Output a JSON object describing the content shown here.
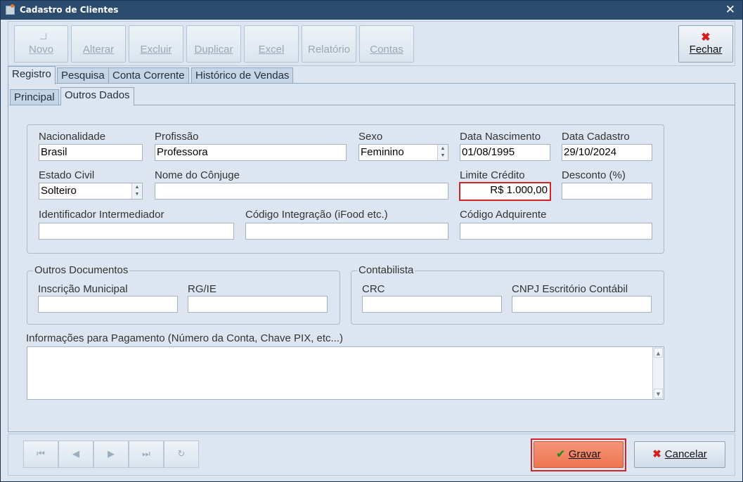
{
  "window": {
    "title": "Cadastro de Clientes",
    "close": "✕"
  },
  "toolbar": {
    "novo": "Novo",
    "alterar": "Alterar",
    "excluir": "Excluir",
    "duplicar": "Duplicar",
    "excel": "Excel",
    "relatorio": "Relatório",
    "contas": "Contas",
    "fechar": "Fechar"
  },
  "tabs": [
    "Registro",
    "Pesquisa",
    "Conta Corrente",
    "Histórico de Vendas"
  ],
  "subtabs": [
    "Principal",
    "Outros Dados"
  ],
  "form": {
    "nacionalidade": {
      "label": "Nacionalidade",
      "value": "Brasil"
    },
    "profissao": {
      "label": "Profissão",
      "value": "Professora"
    },
    "sexo": {
      "label": "Sexo",
      "value": "Feminino"
    },
    "data_nascimento": {
      "label": "Data Nascimento",
      "value": "01/08/1995"
    },
    "data_cadastro": {
      "label": "Data Cadastro",
      "value": "29/10/2024"
    },
    "estado_civil": {
      "label": "Estado Civil",
      "value": "Solteiro"
    },
    "nome_conjuge": {
      "label": "Nome do Cônjuge",
      "value": ""
    },
    "limite_credito": {
      "label": "Limite Crédito",
      "value": "R$ 1.000,00"
    },
    "desconto": {
      "label": "Desconto (%)",
      "value": ""
    },
    "identificador_intermediador": {
      "label": "Identificador Intermediador",
      "value": ""
    },
    "codigo_integracao": {
      "label": "Código Integração (iFood etc.)",
      "value": ""
    },
    "codigo_adquirente": {
      "label": "Código Adquirente",
      "value": ""
    }
  },
  "outros_documentos": {
    "legend": "Outros Documentos",
    "inscricao_municipal": {
      "label": "Inscrição Municipal",
      "value": ""
    },
    "rg_ie": {
      "label": "RG/IE",
      "value": ""
    }
  },
  "contabilista": {
    "legend": "Contabilista",
    "crc": {
      "label": "CRC",
      "value": ""
    },
    "cnpj": {
      "label": "CNPJ Escritório Contábil",
      "value": ""
    }
  },
  "pagamento": {
    "label": "Informações para Pagamento (Número da Conta, Chave PIX, etc...)",
    "value": ""
  },
  "nav": {
    "first": "⏮",
    "prev": "◀",
    "next": "▶",
    "last": "⏭",
    "refresh": "↻"
  },
  "actions": {
    "gravar": "Gravar",
    "cancelar": "Cancelar"
  }
}
